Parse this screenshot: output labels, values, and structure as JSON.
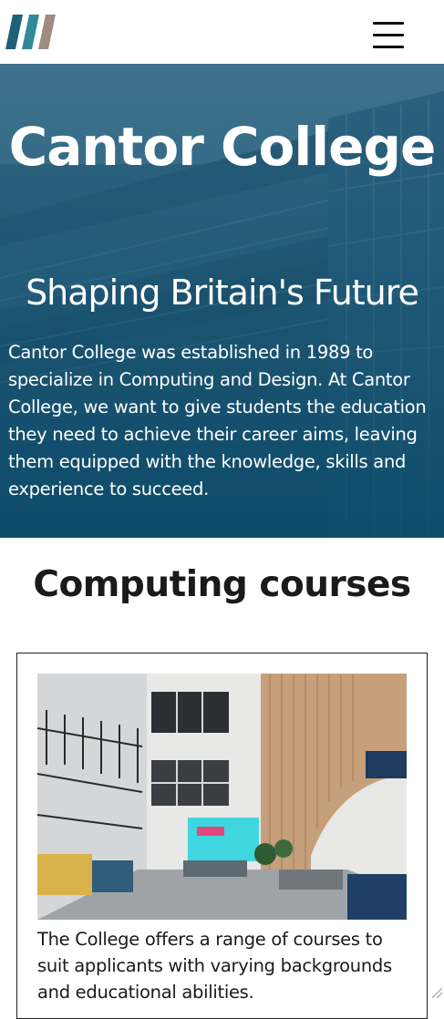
{
  "header": {
    "logo_icon": "college-logo-stripes",
    "logo_colors": [
      "#1f5f7a",
      "#2e8a99",
      "#a08c7e"
    ],
    "menu_icon": "hamburger-menu-icon"
  },
  "hero": {
    "title": "Cantor College",
    "subtitle": "Shaping Britain's Future",
    "description": "Cantor College was established in 1989 to specialize in Computing and Design. At Cantor College, we want to give students the education they need to achieve their career aims, leaving them equipped with the knowledge, skills and experience to succeed.",
    "overlay_color": "#1d5f7f"
  },
  "courses": {
    "heading": "Computing courses",
    "card": {
      "image_alt": "College atrium interior",
      "text": "The College offers a range of courses to suit applicants with varying backgrounds and educational abilities."
    }
  }
}
